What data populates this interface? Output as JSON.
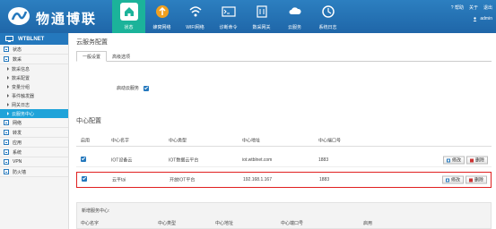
{
  "header": {
    "brand": "物通博联",
    "nav": [
      {
        "label": "状态",
        "icon": "home-icon",
        "active": true
      },
      {
        "label": "蜂窝网络",
        "icon": "cellular-icon"
      },
      {
        "label": "WIFI网络",
        "icon": "wifi-icon"
      },
      {
        "label": "诊断命令",
        "icon": "terminal-icon"
      },
      {
        "label": "数采网关",
        "icon": "gateway-icon"
      },
      {
        "label": "云服务",
        "icon": "cloud-icon"
      },
      {
        "label": "系统日志",
        "icon": "log-icon"
      }
    ],
    "help": "帮助",
    "about": "关于",
    "logout": "退出",
    "user": "admin"
  },
  "sidebar": {
    "title": "WTBLNET",
    "groups": [
      {
        "label": "状态"
      },
      {
        "label": "数采"
      }
    ],
    "subs": [
      {
        "label": "数采信息"
      },
      {
        "label": "数采配置"
      },
      {
        "label": "变量分组"
      },
      {
        "label": "事件触发器"
      },
      {
        "label": "网关日志"
      },
      {
        "label": "云服务中心",
        "active": true
      }
    ],
    "groups2": [
      {
        "label": "网络"
      },
      {
        "label": "转发"
      },
      {
        "label": "应用"
      },
      {
        "label": "系统"
      },
      {
        "label": "VPN"
      },
      {
        "label": "防火墙"
      }
    ]
  },
  "main": {
    "page_title": "云服务配置",
    "tabs": [
      {
        "label": "一般设置",
        "active": true
      },
      {
        "label": "高级选项"
      }
    ],
    "enable_label": "启动云服务",
    "enable_checked": true,
    "section_title": "中心配置",
    "table": {
      "headers": [
        "启用",
        "中心名字",
        "中心类型",
        "中心地址",
        "中心端口号"
      ],
      "rows": [
        {
          "enabled": true,
          "name": "IOT设备云",
          "type": "IOT数据云平台",
          "address": "iot.wtblnet.com",
          "port": "1883"
        },
        {
          "enabled": true,
          "name": "云平tai",
          "type": "开放IOT平台",
          "address": "192.168.1.167",
          "port": "1883"
        }
      ],
      "edit_label": "修改",
      "delete_label": "删除"
    },
    "add": {
      "title": "新增服务中心:",
      "headers": [
        "中心名字",
        "中心类型",
        "中心地址",
        "中心端口号",
        "启用"
      ]
    }
  },
  "colors": {
    "header_blue": "#2c7fc0",
    "active_green": "#1bb39a",
    "sidebar_active": "#1fa3d9",
    "highlight_red": "#e02020"
  }
}
